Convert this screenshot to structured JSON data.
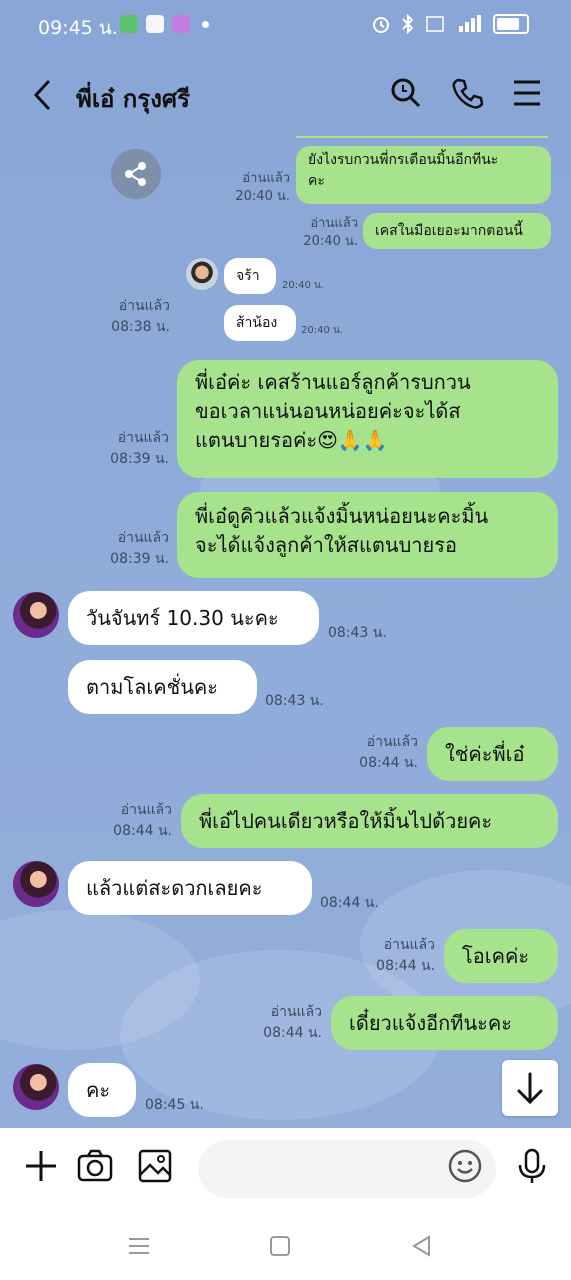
{
  "status_bar": {
    "time": "09:45 น."
  },
  "header": {
    "title": "พี่เอ๋ กรุงศรี"
  },
  "messages": [
    {
      "id": "m1",
      "side": "right",
      "text_lines": [
        "ยังไงรบกวนพี่กรเตือนมิ้นอีกทีนะ",
        "คะ"
      ],
      "read": "อ่านแล้ว",
      "time": "20:40 น."
    },
    {
      "id": "m2",
      "side": "right",
      "text_lines": [
        "เคสในมือเยอะมากตอนนี้"
      ],
      "read": "อ่านแล้ว",
      "time": "20:40 น."
    },
    {
      "id": "m3",
      "side": "left",
      "text_lines": [
        "จร้า"
      ],
      "time": "20:40 น."
    },
    {
      "id": "m4",
      "side": "left",
      "text_lines": [
        "ส้าน้อง"
      ],
      "time": "20:40 น."
    },
    {
      "id": "m5",
      "side": "right",
      "text_lines": [
        "พี่เอ๋ค่ะ เคสร้านแอร์ลูกค้ารบกวน",
        "ขอเวลาแน่นอนหน่อยค่ะจะได้ส",
        "แตนบายรอค่ะ😍🙏🙏"
      ],
      "read": "อ่านแล้ว",
      "time": "08:39 น."
    },
    {
      "id": "m6",
      "side": "right",
      "text_lines": [
        "พี่เอ๋ดูคิวแล้วแจ้งมิ้นหน่อยนะคะมิ้น",
        "จะได้แจ้งลูกค้าให้สแตนบายรอ"
      ],
      "read": "อ่านแล้ว",
      "time": "08:39 น."
    },
    {
      "id": "m7",
      "side": "left",
      "text_lines": [
        "วันจันทร์ 10.30 นะคะ"
      ],
      "time": "08:43 น."
    },
    {
      "id": "m8",
      "side": "left",
      "text_lines": [
        "ตามโลเคชั่นคะ"
      ],
      "time": "08:43 น."
    },
    {
      "id": "m9",
      "side": "right",
      "text_lines": [
        "ใช่ค่ะพี่เอ๋"
      ],
      "read": "อ่านแล้ว",
      "time": "08:44 น."
    },
    {
      "id": "m10",
      "side": "right",
      "text_lines": [
        "พี่เอ๋ไปคนเดียวหรือให้มิ้นไปด้วยคะ"
      ],
      "read": "อ่านแล้ว",
      "time": "08:44 น."
    },
    {
      "id": "m11",
      "side": "left",
      "text_lines": [
        "แล้วแต่สะดวกเลยคะ"
      ],
      "time": "08:44 น."
    },
    {
      "id": "m12",
      "side": "right",
      "text_lines": [
        "โอเคค่ะ"
      ],
      "read": "อ่านแล้ว",
      "time": "08:44 น."
    },
    {
      "id": "m13",
      "side": "right",
      "text_lines": [
        "เดี๋ยวแจ้งอีกทีนะคะ"
      ],
      "read": "อ่านแล้ว",
      "time": "08:44 น."
    },
    {
      "id": "m14",
      "side": "left",
      "text_lines": [
        "คะ"
      ],
      "time": "08:45 น."
    }
  ],
  "extra_read_receipt": {
    "read": "อ่านแล้ว",
    "time": "08:38 น."
  },
  "input": {
    "placeholder": ""
  },
  "icons": {
    "back": "back-arrow-icon",
    "search": "search-icon",
    "call": "phone-icon",
    "menu": "menu-icon",
    "share": "share-icon",
    "plus": "plus-icon",
    "camera": "camera-icon",
    "image": "image-icon",
    "emoji": "emoji-icon",
    "mic": "microphone-icon",
    "scroll": "arrow-down-icon"
  },
  "colors": {
    "chat_bg": "#8fabd9",
    "outgoing": "#a6e38c",
    "incoming": "#ffffff"
  }
}
